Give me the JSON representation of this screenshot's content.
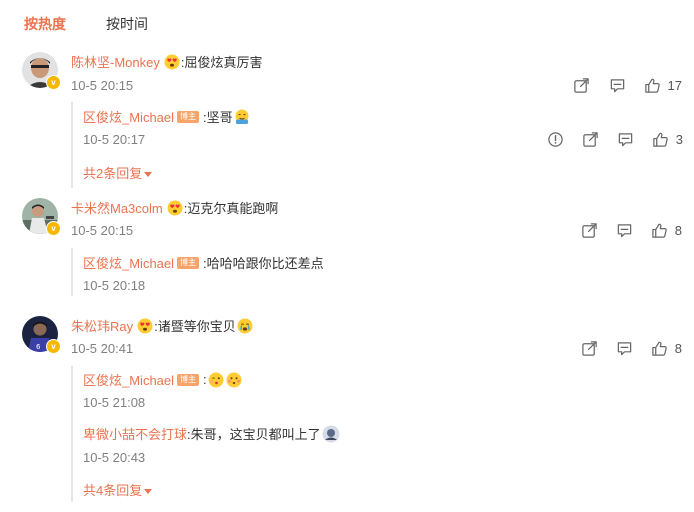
{
  "tabs": [
    {
      "label": "按热度"
    },
    {
      "label": "按时间"
    }
  ],
  "comments": [
    {
      "user": "陈林坚-Monkey",
      "text": ":屈俊炫真厉害",
      "time": "10-5 20:15",
      "likes": "17",
      "replies": [
        {
          "user": "区俊炫_Michael",
          "badge": "博主",
          "text": ":坚哥",
          "time": "10-5 20:17",
          "likes": "3"
        }
      ],
      "more_label": "共2条回复"
    },
    {
      "user": "卡米然Ma3colm",
      "text": ":迈克尔真能跑啊",
      "time": "10-5 20:15",
      "likes": "8",
      "replies": [
        {
          "user": "区俊炫_Michael",
          "badge": "博主",
          "text": ":哈哈哈跟你比还差点",
          "time": "10-5 20:18"
        }
      ]
    },
    {
      "user": "朱松玮Ray",
      "text": ":诸暨等你宝贝",
      "time": "10-5 20:41",
      "likes": "8",
      "replies": [
        {
          "user": "区俊炫_Michael",
          "badge": "博主",
          "text": ":",
          "time": "10-5 21:08"
        },
        {
          "user": "卑微小喆不会打球",
          "text": ":朱哥，这宝贝都叫上了",
          "time": "10-5 20:43"
        }
      ],
      "more_label": "共4条回复"
    }
  ],
  "icons": {
    "share": "share-icon",
    "comment": "comment-icon",
    "like": "like-icon",
    "report": "report-icon",
    "vip": "vip-badge-icon",
    "emoji": "emoji-icon"
  },
  "colors": {
    "accent": "#eb7350",
    "badge": "#f7a46a",
    "vip": "#f5b800",
    "muted": "#808080"
  }
}
